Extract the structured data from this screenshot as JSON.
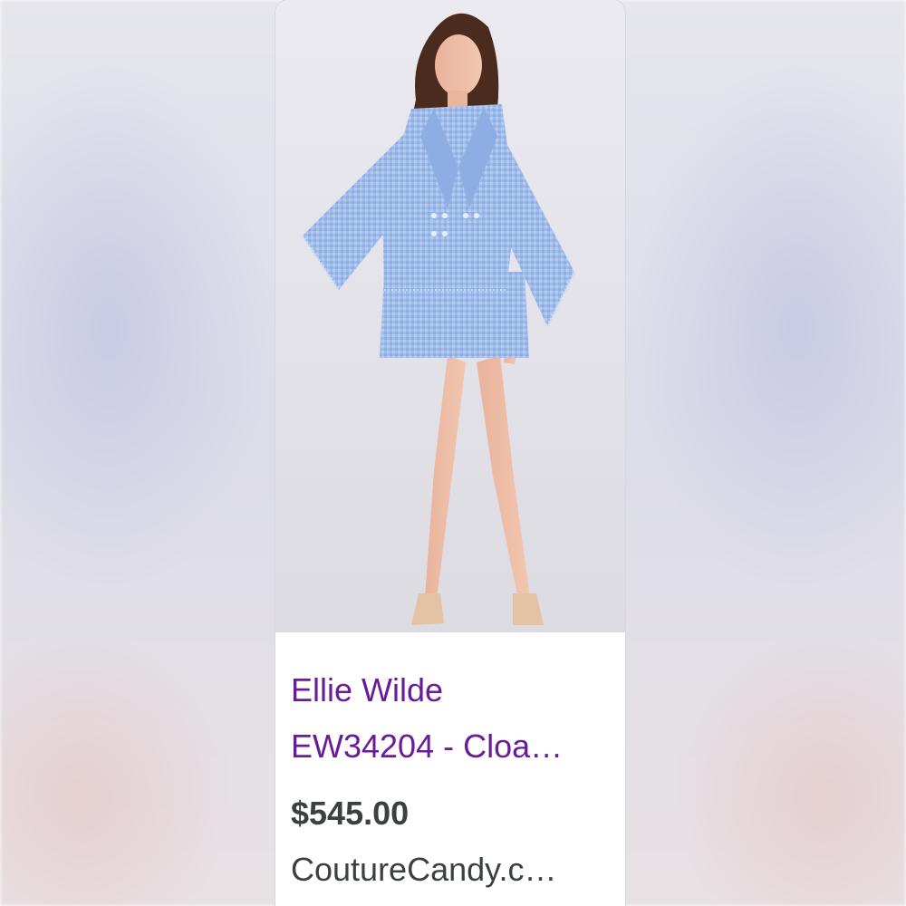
{
  "product": {
    "title_line1": "Ellie Wilde",
    "title_line2": "EW34204 - Cloa…",
    "price": "$545.00",
    "merchant": "CoutureCandy.c…",
    "image_alt": "model-in-blue-tweed-cape-jacket-and-skirt"
  },
  "colors": {
    "title": "#6a1b9a",
    "text": "#3c4043",
    "garment": "#9fbbe9",
    "card_bg": "#ffffff"
  }
}
